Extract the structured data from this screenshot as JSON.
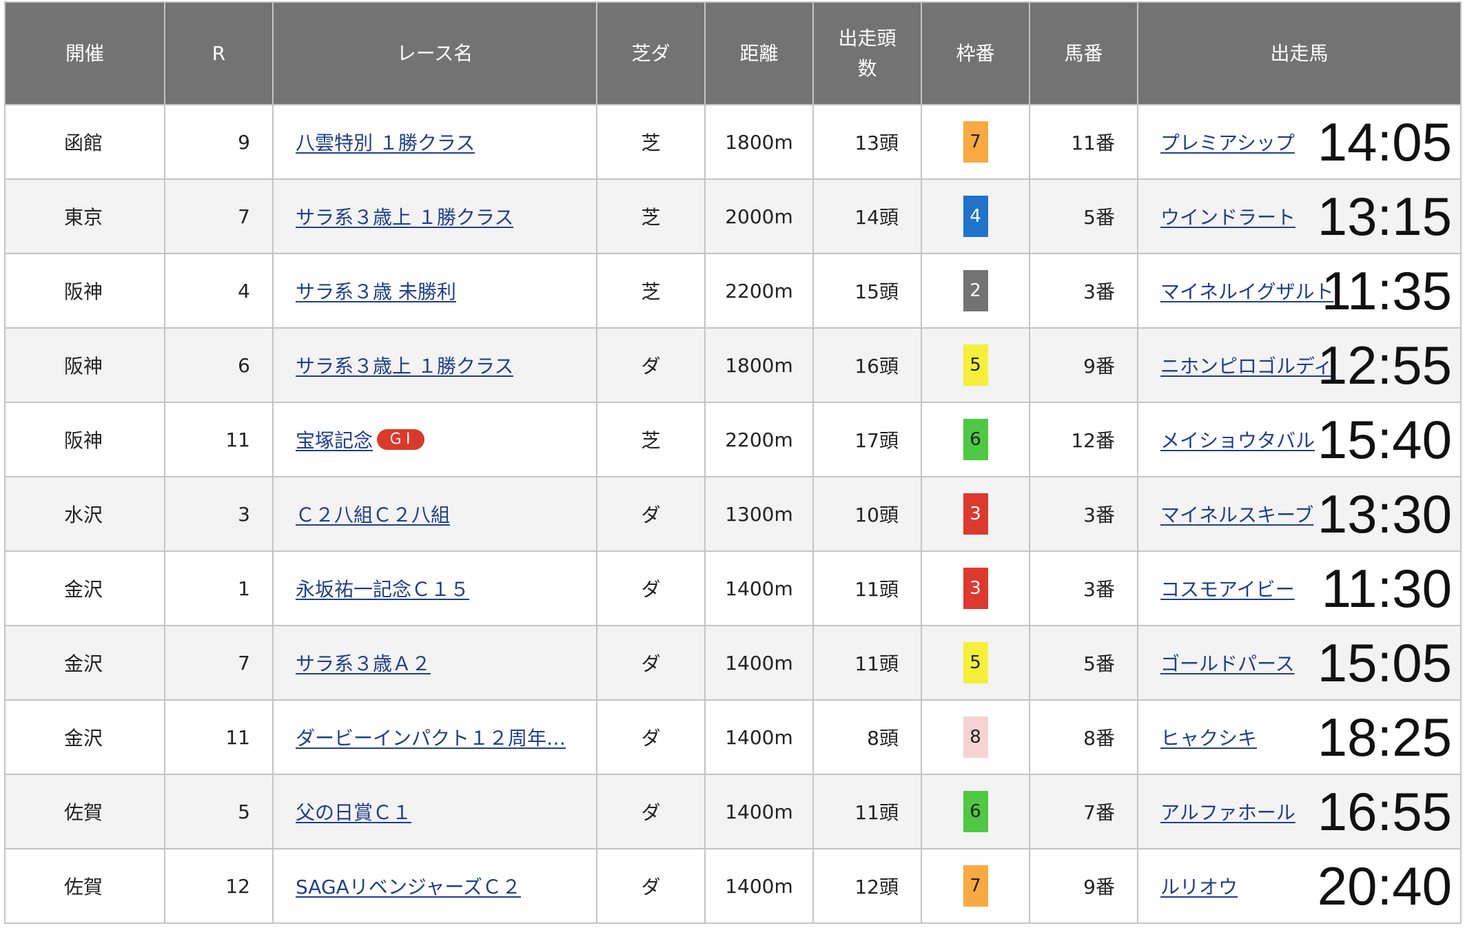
{
  "header": {
    "venue": "開催",
    "race_no": "R",
    "race_name": "レース名",
    "surface": "芝ダ",
    "distance": "距離",
    "runners_line1": "出走頭",
    "runners_line2": "数",
    "frame": "枠番",
    "horse_no": "馬番",
    "horse": "出走馬"
  },
  "rows": [
    {
      "venue": "函館",
      "r": "9",
      "name": "八雲特別 １勝クラス",
      "grade": "",
      "surface": "芝",
      "distance": "1800m",
      "runners": "13頭",
      "frame": "7",
      "frame_bg": "#f9a942",
      "frame_fg": "#222222",
      "horse_no": "11番",
      "horse": "プレミアシップ",
      "time": "14:05"
    },
    {
      "venue": "東京",
      "r": "7",
      "name": "サラ系３歳上 １勝クラス",
      "grade": "",
      "surface": "芝",
      "distance": "2000m",
      "runners": "14頭",
      "frame": "4",
      "frame_bg": "#1f73c9",
      "frame_fg": "#ffffff",
      "horse_no": "5番",
      "horse": "ウインドラート",
      "time": "13:15"
    },
    {
      "venue": "阪神",
      "r": "4",
      "name": "サラ系３歳 未勝利",
      "grade": "",
      "surface": "芝",
      "distance": "2200m",
      "runners": "15頭",
      "frame": "2",
      "frame_bg": "#737373",
      "frame_fg": "#ffffff",
      "horse_no": "3番",
      "horse": "マイネルイグザルト",
      "time": "11:35"
    },
    {
      "venue": "阪神",
      "r": "6",
      "name": "サラ系３歳上 １勝クラス",
      "grade": "",
      "surface": "ダ",
      "distance": "1800m",
      "runners": "16頭",
      "frame": "5",
      "frame_bg": "#f5ef3c",
      "frame_fg": "#222222",
      "horse_no": "9番",
      "horse": "ニホンピロゴルディ",
      "time": "12:55"
    },
    {
      "venue": "阪神",
      "r": "11",
      "name": "宝塚記念",
      "grade": "ＧⅠ",
      "surface": "芝",
      "distance": "2200m",
      "runners": "17頭",
      "frame": "6",
      "frame_bg": "#4fc843",
      "frame_fg": "#222222",
      "horse_no": "12番",
      "horse": "メイショウタバル",
      "time": "15:40"
    },
    {
      "venue": "水沢",
      "r": "3",
      "name": "Ｃ２八組Ｃ２八組",
      "grade": "",
      "surface": "ダ",
      "distance": "1300m",
      "runners": "10頭",
      "frame": "3",
      "frame_bg": "#dc3a2f",
      "frame_fg": "#ffffff",
      "horse_no": "3番",
      "horse": "マイネルスキーブ",
      "time": "13:30"
    },
    {
      "venue": "金沢",
      "r": "1",
      "name": "永坂祐一記念Ｃ１５",
      "grade": "",
      "surface": "ダ",
      "distance": "1400m",
      "runners": "11頭",
      "frame": "3",
      "frame_bg": "#dc3a2f",
      "frame_fg": "#ffffff",
      "horse_no": "3番",
      "horse": "コスモアイビー",
      "time": "11:30"
    },
    {
      "venue": "金沢",
      "r": "7",
      "name": "サラ系３歳Ａ２",
      "grade": "",
      "surface": "ダ",
      "distance": "1400m",
      "runners": "11頭",
      "frame": "5",
      "frame_bg": "#f5ef3c",
      "frame_fg": "#222222",
      "horse_no": "5番",
      "horse": "ゴールドパース",
      "time": "15:05"
    },
    {
      "venue": "金沢",
      "r": "11",
      "name": "ダービーインパクト１２周年…",
      "grade": "",
      "surface": "ダ",
      "distance": "1400m",
      "runners": "8頭",
      "frame": "8",
      "frame_bg": "#f6d3d2",
      "frame_fg": "#222222",
      "horse_no": "8番",
      "horse": "ヒャクシキ",
      "time": "18:25"
    },
    {
      "venue": "佐賀",
      "r": "5",
      "name": "父の日賞Ｃ１",
      "grade": "",
      "surface": "ダ",
      "distance": "1400m",
      "runners": "11頭",
      "frame": "6",
      "frame_bg": "#4fc843",
      "frame_fg": "#222222",
      "horse_no": "7番",
      "horse": "アルファホール",
      "time": "16:55"
    },
    {
      "venue": "佐賀",
      "r": "12",
      "name": "SAGAリベンジャーズＣ２",
      "grade": "",
      "surface": "ダ",
      "distance": "1400m",
      "runners": "12頭",
      "frame": "7",
      "frame_bg": "#f9a942",
      "frame_fg": "#222222",
      "horse_no": "9番",
      "horse": "ルリオウ",
      "time": "20:40"
    }
  ]
}
